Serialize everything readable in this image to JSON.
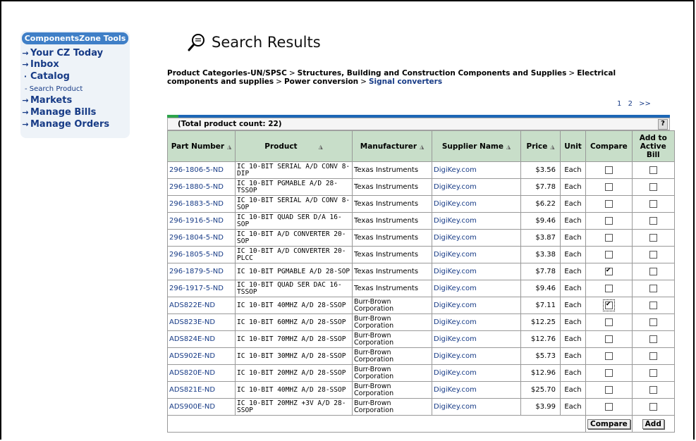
{
  "sidebar": {
    "title": "ComponentsZone Tools",
    "items": [
      {
        "label": "Your CZ Today"
      },
      {
        "label": "Inbox"
      },
      {
        "label": "Catalog"
      },
      {
        "label": "Markets"
      },
      {
        "label": "Manage Bills"
      },
      {
        "label": "Manage Orders"
      }
    ],
    "sub_item": "- Search Product"
  },
  "header": {
    "title": "Search Results"
  },
  "breadcrumb": {
    "c1": "Product Categories-UN/SPSC",
    "c2": "Structures, Building and Construction Components and Supplies",
    "c3": "Electrical components and supplies",
    "c4": "Power conversion",
    "c5": "Signal converters",
    "sep": ">"
  },
  "pager": {
    "p1": "1",
    "p2": "2",
    "next": ">>"
  },
  "table": {
    "count_label": "(Total product count: 22)",
    "help": "?",
    "headers": {
      "part": "Part Number",
      "product": "Product",
      "manufacturer": "Manufacturer",
      "supplier": "Supplier Name",
      "price": "Price",
      "unit": "Unit",
      "compare": "Compare",
      "add": "Add to Active Bill"
    },
    "rows": [
      {
        "part": "296-1806-5-ND",
        "product": "IC 10-BIT SERIAL A/D CONV 8-DIP",
        "mfr": "Texas Instruments",
        "supplier": "DigiKey.com",
        "price": "$3.56",
        "unit": "Each",
        "compare": false,
        "add": false
      },
      {
        "part": "296-1880-5-ND",
        "product": "IC 10-BIT PGMABLE A/D 28-TSSOP",
        "mfr": "Texas Instruments",
        "supplier": "DigiKey.com",
        "price": "$7.78",
        "unit": "Each",
        "compare": false,
        "add": false
      },
      {
        "part": "296-1883-5-ND",
        "product": "IC 10-BIT SERIAL A/D CONV 8-SOP",
        "mfr": "Texas Instruments",
        "supplier": "DigiKey.com",
        "price": "$6.22",
        "unit": "Each",
        "compare": false,
        "add": false
      },
      {
        "part": "296-1916-5-ND",
        "product": "IC 10-BIT QUAD SER D/A 16-SOP",
        "mfr": "Texas Instruments",
        "supplier": "DigiKey.com",
        "price": "$9.46",
        "unit": "Each",
        "compare": false,
        "add": false
      },
      {
        "part": "296-1804-5-ND",
        "product": "IC 10-BIT A/D CONVERTER 20-SOP",
        "mfr": "Texas Instruments",
        "supplier": "DigiKey.com",
        "price": "$3.87",
        "unit": "Each",
        "compare": false,
        "add": false
      },
      {
        "part": "296-1805-5-ND",
        "product": "IC 10-BIT A/D CONVERTER 20-PLCC",
        "mfr": "Texas Instruments",
        "supplier": "DigiKey.com",
        "price": "$3.38",
        "unit": "Each",
        "compare": false,
        "add": false
      },
      {
        "part": "296-1879-5-ND",
        "product": "IC 10-BIT PGMABLE A/D 28-SOP",
        "mfr": "Texas Instruments",
        "supplier": "DigiKey.com",
        "price": "$7.78",
        "unit": "Each",
        "compare": true,
        "add": false
      },
      {
        "part": "296-1917-5-ND",
        "product": "IC 10-BIT QUAD SER DAC 16-TSSOP",
        "mfr": "Texas Instruments",
        "supplier": "DigiKey.com",
        "price": "$9.46",
        "unit": "Each",
        "compare": false,
        "add": false
      },
      {
        "part": "ADS822E-ND",
        "product": "IC 10-BIT 40MHZ A/D 28-SSOP",
        "mfr": "Burr-Brown Corporation",
        "supplier": "DigiKey.com",
        "price": "$7.11",
        "unit": "Each",
        "compare": true,
        "add": false
      },
      {
        "part": "ADS823E-ND",
        "product": "IC 10-BIT 60MHZ A/D 28-SSOP",
        "mfr": "Burr-Brown Corporation",
        "supplier": "DigiKey.com",
        "price": "$12.25",
        "unit": "Each",
        "compare": false,
        "add": false
      },
      {
        "part": "ADS824E-ND",
        "product": "IC 10-BIT 70MHZ A/D 28-SSOP",
        "mfr": "Burr-Brown Corporation",
        "supplier": "DigiKey.com",
        "price": "$12.76",
        "unit": "Each",
        "compare": false,
        "add": false
      },
      {
        "part": "ADS902E-ND",
        "product": "IC 10-BIT 30MHZ A/D 28-SSOP",
        "mfr": "Burr-Brown Corporation",
        "supplier": "DigiKey.com",
        "price": "$5.73",
        "unit": "Each",
        "compare": false,
        "add": false
      },
      {
        "part": "ADS820E-ND",
        "product": "IC 10-BIT 20MHZ A/D 28-SSOP",
        "mfr": "Burr-Brown Corporation",
        "supplier": "DigiKey.com",
        "price": "$12.96",
        "unit": "Each",
        "compare": false,
        "add": false
      },
      {
        "part": "ADS821E-ND",
        "product": "IC 10-BIT 40MHZ A/D 28-SSOP",
        "mfr": "Burr-Brown Corporation",
        "supplier": "DigiKey.com",
        "price": "$25.70",
        "unit": "Each",
        "compare": false,
        "add": false
      },
      {
        "part": "ADS900E-ND",
        "product": "IC 10-BIT 20MHZ +3V A/D 28-SSOP",
        "mfr": "Burr-Brown Corporation",
        "supplier": "DigiKey.com",
        "price": "$3.99",
        "unit": "Each",
        "compare": false,
        "add": false
      }
    ],
    "compare_button": "Compare",
    "add_button": "Add"
  },
  "icons": {
    "title_icon": "magnifier-speech-icon",
    "nav_arrow": "arrow-right-icon",
    "sort": "sort-triangle-icon"
  }
}
